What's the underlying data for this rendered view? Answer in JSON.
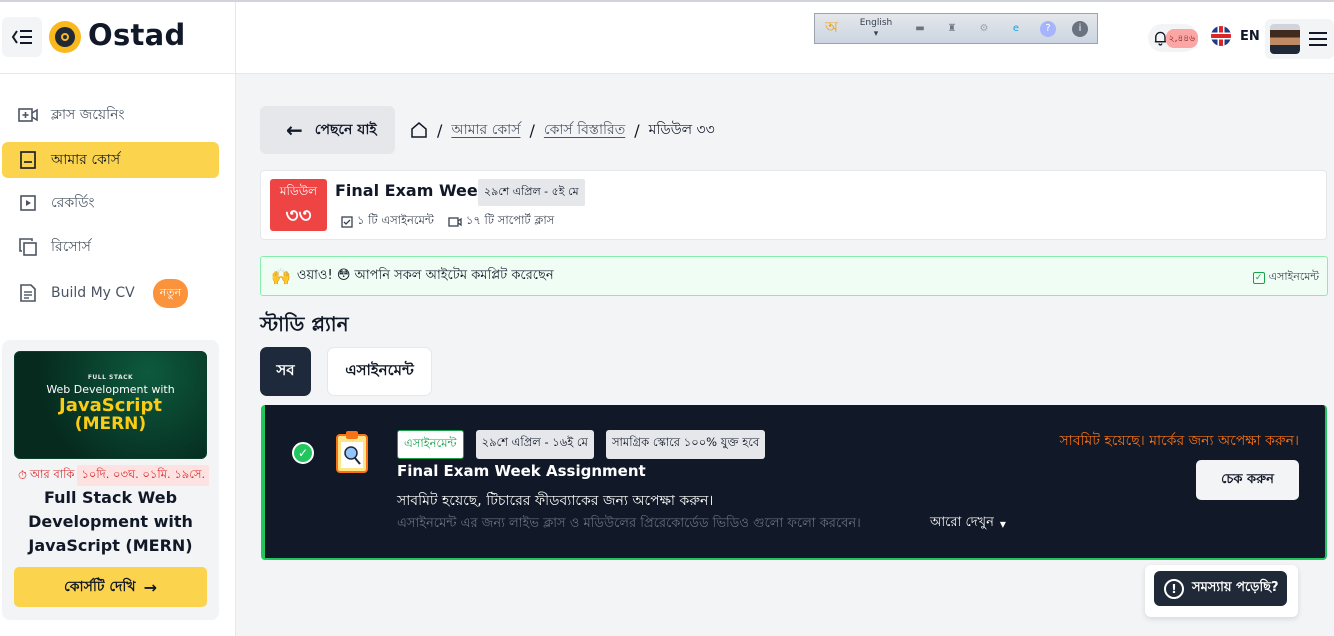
{
  "app": {
    "name": "Ostad"
  },
  "sidebar": {
    "items": [
      {
        "label": "ক্লাস জয়েনিং",
        "icon": "video-plus-icon"
      },
      {
        "label": "আমার কোর্স",
        "icon": "book-icon"
      },
      {
        "label": "রেকর্ডিং",
        "icon": "play-square-icon"
      },
      {
        "label": "রিসোর্স",
        "icon": "copy-icon"
      },
      {
        "label": "Build My CV",
        "icon": "document-icon",
        "badge": "নতুন"
      }
    ],
    "promo": {
      "image_line1": "FULL STACK",
      "image_line2": "Web Development with",
      "image_line3": "JavaScript",
      "image_line4": "(MERN)",
      "timer_label": "আর বাকি",
      "timer_value": "১০দি. ০৩ঘ. ০১মি. ১৯সে.",
      "title": "Full Stack Web Development with JavaScript (MERN)",
      "button": "কোর্সটি দেখি"
    }
  },
  "header": {
    "avro_language": "English",
    "notifications_count": "২,৪৪৬",
    "language": "EN"
  },
  "main": {
    "back_button": "পেছনে যাই",
    "breadcrumb": [
      "আমার কোর্স",
      "কোর্স বিস্তারিত",
      "মডিউল ৩৩"
    ],
    "module": {
      "label": "মডিউল",
      "number": "৩৩",
      "title": "Final Exam Week",
      "date": "২৯শে এপ্রিল - ৫ই মে",
      "assignments": "১ টি এসাইনমেন্ট",
      "support_classes": "১৭ টি সাপোর্ট ক্লাস"
    },
    "completion": {
      "message": "ওয়াও! 😳 আপনি সকল আইটেম কমপ্লিট করেছেন",
      "right_label": "এসাইনমেন্ট"
    },
    "study_plan_title": "স্টাডি প্ল্যান",
    "tabs": [
      "সব",
      "এসাইনমেন্ট"
    ],
    "assignment": {
      "type_tag": "এসাইনমেন্ট",
      "date_tag": "২৯শে এপ্রিল - ১৬ই মে",
      "score_tag": "সামগ্রিক স্কোরে ১০০% যুক্ত হবে",
      "title": "Final Exam Week Assignment",
      "status": "সাবমিট হয়েছে, টিচারের ফীডব্যাকের জন্য অপেক্ষা করুন।",
      "description": "এসাইনমেন্ট এর জন্য লাইভ ক্লাস ও মডিউলের প্রিরেকোর্ডেড ভিডিও গুলো ফলো করবেন।",
      "more": "আরো দেখুন",
      "warning": "সাবমিট হয়েছে। মার্কের জন্য অপেক্ষা করুন।",
      "check_button": "চেক করুন"
    },
    "help_button": "সমস্যায় পড়েছি?"
  },
  "colors": {
    "accent": "#fcd34d",
    "card_dark": "#111827",
    "success": "#22c55e",
    "warning": "#f97316",
    "module_badge": "#ef4444"
  }
}
